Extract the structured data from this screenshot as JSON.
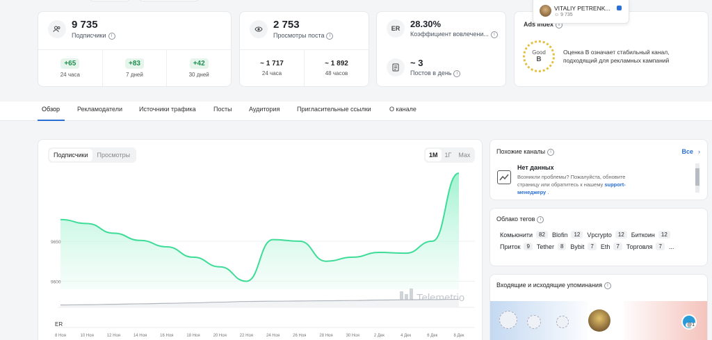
{
  "stats": {
    "subscribers": {
      "icon": "users-icon",
      "value": "9 735",
      "label": "Подписчики",
      "sub": [
        {
          "delta": "+65",
          "period": "24 часа"
        },
        {
          "delta": "+83",
          "period": "7 дней"
        },
        {
          "delta": "+42",
          "period": "30 дней"
        }
      ]
    },
    "views": {
      "icon": "eye-icon",
      "value": "2 753",
      "label": "Просмотры поста",
      "sub": [
        {
          "value": "~ 1 717",
          "period": "24 часа"
        },
        {
          "value": "~ 1 892",
          "period": "48 часов"
        }
      ]
    },
    "er": {
      "icon_text": "ER",
      "value": "28.30%",
      "label": "Коэффициент вовлечени..."
    },
    "posts": {
      "icon": "document-icon",
      "value": "~ 3",
      "label": "Постов в день"
    },
    "ads_index": {
      "title": "Ads Index",
      "grade_word": "Good",
      "grade_letter": "B",
      "description": "Оценка B означает стабильный канал, подходящий для рекламных кампаний"
    }
  },
  "channel_popup": {
    "name": "VITALIY PETRENK...",
    "subs": "9 735"
  },
  "tabs": [
    "Обзор",
    "Рекламодатели",
    "Источники трафика",
    "Посты",
    "Аудитория",
    "Пригласительные ссылки",
    "О канале"
  ],
  "chart_panel": {
    "toggle": [
      "Подписчики",
      "Просмотры"
    ],
    "ranges": [
      "1М",
      "1Г",
      "Max"
    ],
    "watermark": "Telemetrio",
    "er_label": "ER"
  },
  "chart_data": {
    "type": "area",
    "x": [
      "8 Ноя",
      "10 Ноя",
      "12 Ноя",
      "14 Ноя",
      "16 Ноя",
      "18 Ноя",
      "20 Ноя",
      "22 Ноя",
      "24 Ноя",
      "26 Ноя",
      "28 Ноя",
      "30 Ноя",
      "2 Дек",
      "4 Дек",
      "6 Дек",
      "8 Дек"
    ],
    "y_ticks": [
      9600,
      9650
    ],
    "ylim": [
      9590,
      9735
    ],
    "series": [
      {
        "values": [
          9677,
          9672,
          9660,
          9651,
          9643,
          9630,
          9618,
          9600,
          9652,
          9650,
          9625,
          9630,
          9636,
          9635,
          9650,
          9735
        ]
      }
    ],
    "er_values": [
      0.2,
      0.22,
      0.26,
      0.3,
      0.34,
      0.38,
      0.44,
      0.5,
      0.52,
      0.54,
      0.56,
      0.58,
      0.62,
      0.64,
      0.66,
      0.68
    ]
  },
  "similar": {
    "title": "Похожие каналы",
    "all": "Все",
    "empty_title": "Нет данных",
    "empty_text": "Возникли проблемы? Пожалуйста, обновите страницу или обратитесь к нашему",
    "link": "support-менеджеру",
    "after": "."
  },
  "tags": {
    "title": "Облако тегов",
    "items": [
      {
        "t": "Комьюнити",
        "c": "82"
      },
      {
        "t": "Blofin",
        "c": "12"
      },
      {
        "t": "Vpcrypto",
        "c": "12"
      },
      {
        "t": "Биткоин",
        "c": "12"
      },
      {
        "t": "Приток",
        "c": "9"
      },
      {
        "t": "Tether",
        "c": "8"
      },
      {
        "t": "Bybit",
        "c": "7"
      },
      {
        "t": "Eth",
        "c": "7"
      },
      {
        "t": "Торговля",
        "c": "7"
      }
    ],
    "more": "..."
  },
  "mentions": {
    "title": "Входящие и исходящие упоминания",
    "badge": "@1"
  },
  "colors": {
    "accent": "#2a6fd6",
    "area_line": "#3ddc97",
    "area_fill": "#c7f5e2",
    "green": "#1e8e4e"
  }
}
